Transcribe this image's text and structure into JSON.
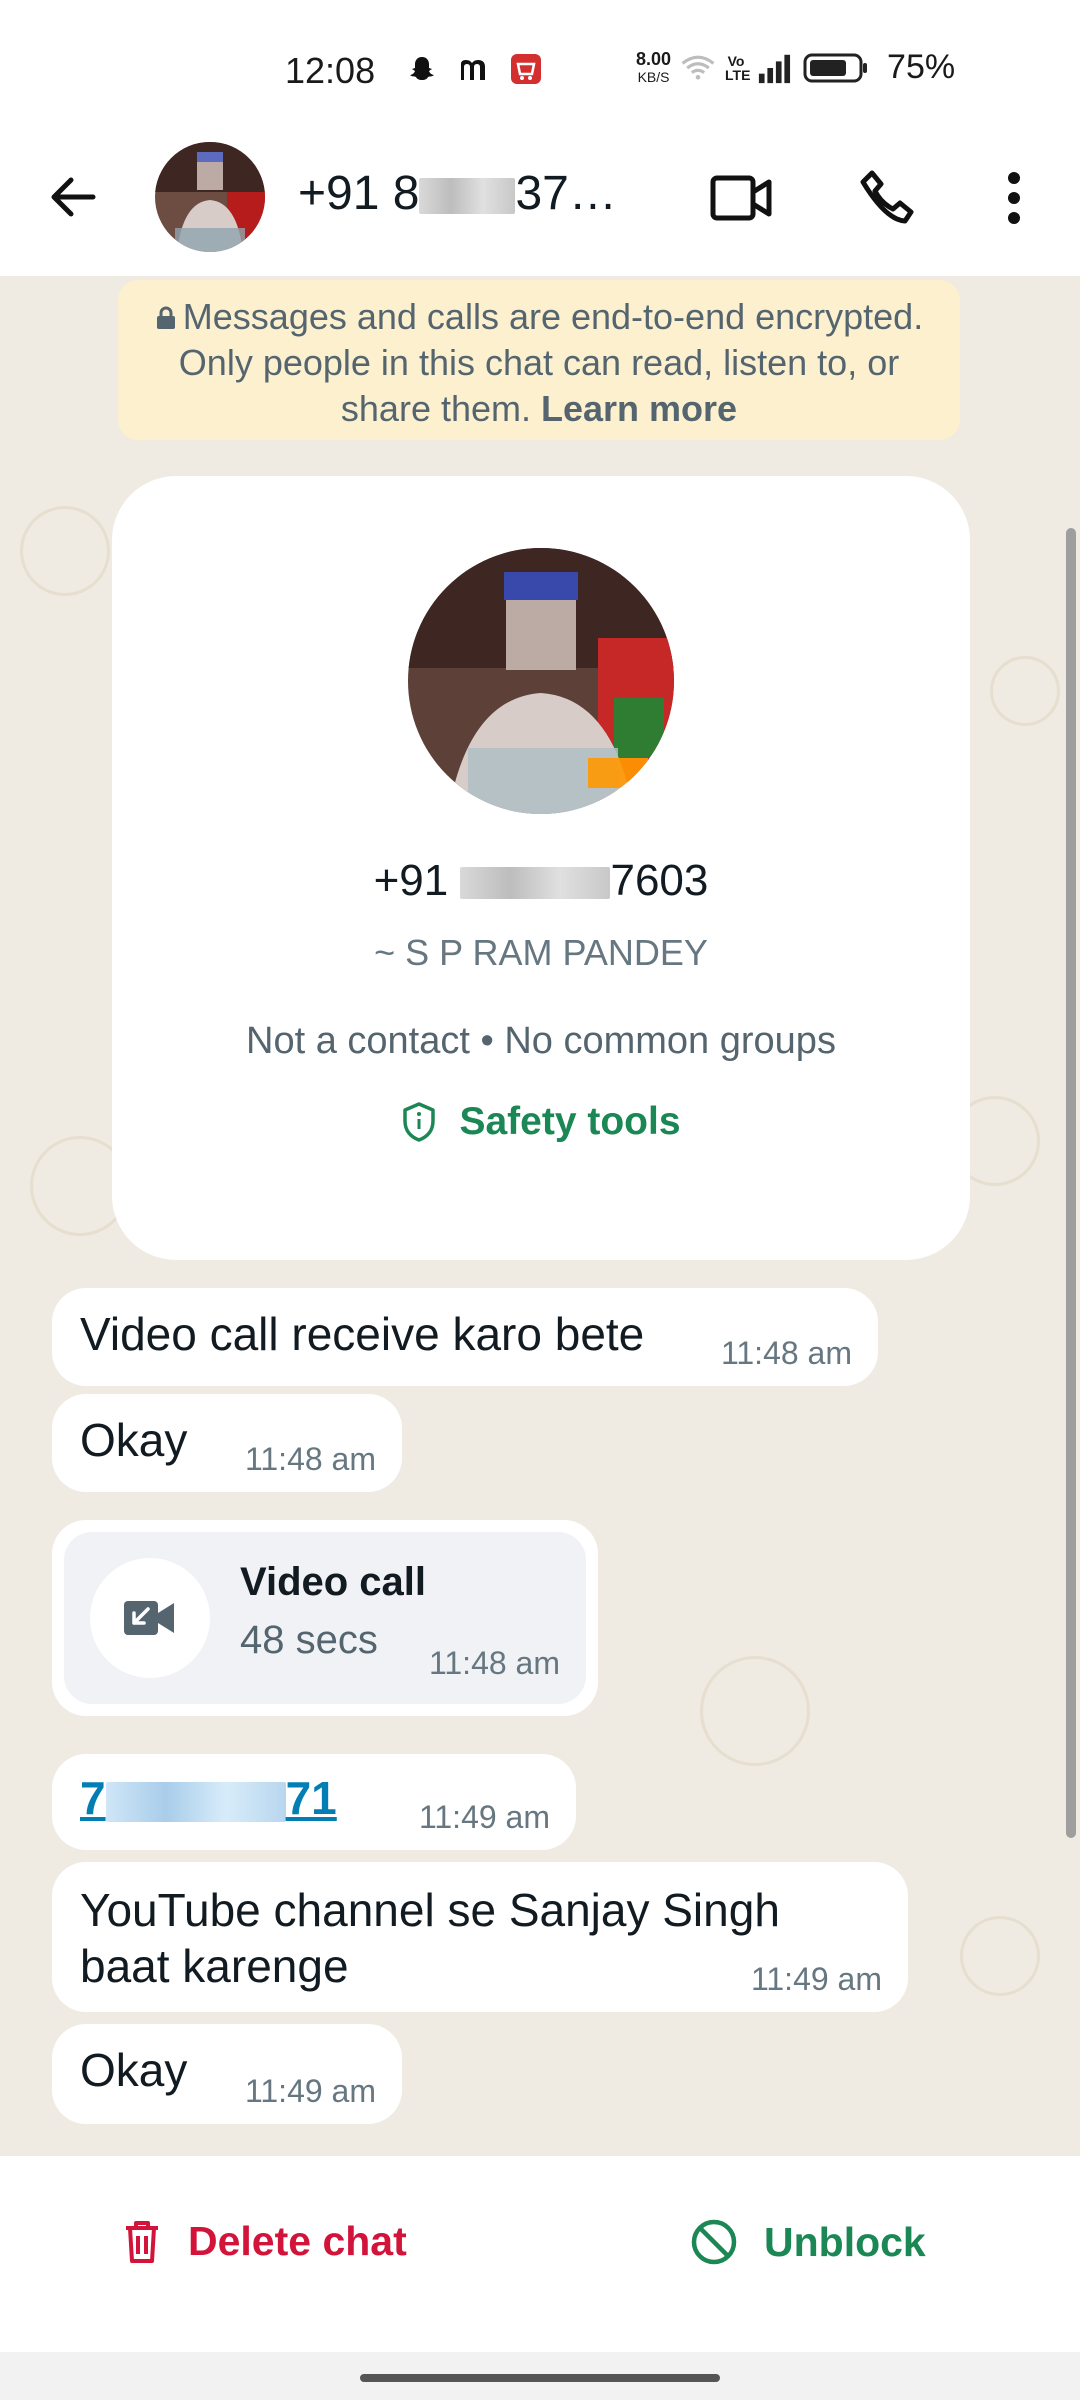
{
  "status_bar": {
    "time": "12:08",
    "net_speed_value": "8.00",
    "net_speed_unit": "KB/S",
    "volte": "Vo LTE",
    "battery": "75%"
  },
  "app_bar": {
    "title_prefix": "+91 8",
    "title_suffix": "37…",
    "icons": [
      "back-arrow-icon",
      "video-camera-icon",
      "phone-icon",
      "more-vert-icon"
    ]
  },
  "encryption_banner": {
    "text": "Messages and calls are end-to-end encrypted. Only people in this chat can read, listen to, or share them.",
    "learn_more": "Learn more"
  },
  "profile": {
    "phone_prefix": "+91",
    "phone_suffix": "7603",
    "name": "~ S P RAM PANDEY",
    "meta": "Not a contact • No common groups",
    "safety_label": "Safety tools"
  },
  "messages": [
    {
      "text": "Video call receive karo bete",
      "time": "11:48 am"
    },
    {
      "text": "Okay",
      "time": "11:48 am"
    },
    {
      "type": "video_call",
      "title": "Video call",
      "duration": "48 secs",
      "time": "11:48 am"
    },
    {
      "type": "link",
      "prefix": "7",
      "suffix": "71",
      "time": "11:49 am"
    },
    {
      "text": "YouTube channel se Sanjay Singh baat karenge",
      "time": "11:49 am"
    },
    {
      "text": "Okay",
      "time": "11:49 am"
    }
  ],
  "bottom_actions": {
    "delete_label": "Delete chat",
    "unblock_label": "Unblock"
  },
  "colors": {
    "chat_bg": "#efeae2",
    "banner_bg": "#fcf0cf",
    "green": "#1b8755",
    "red": "#d2143a",
    "link": "#027eb5"
  }
}
